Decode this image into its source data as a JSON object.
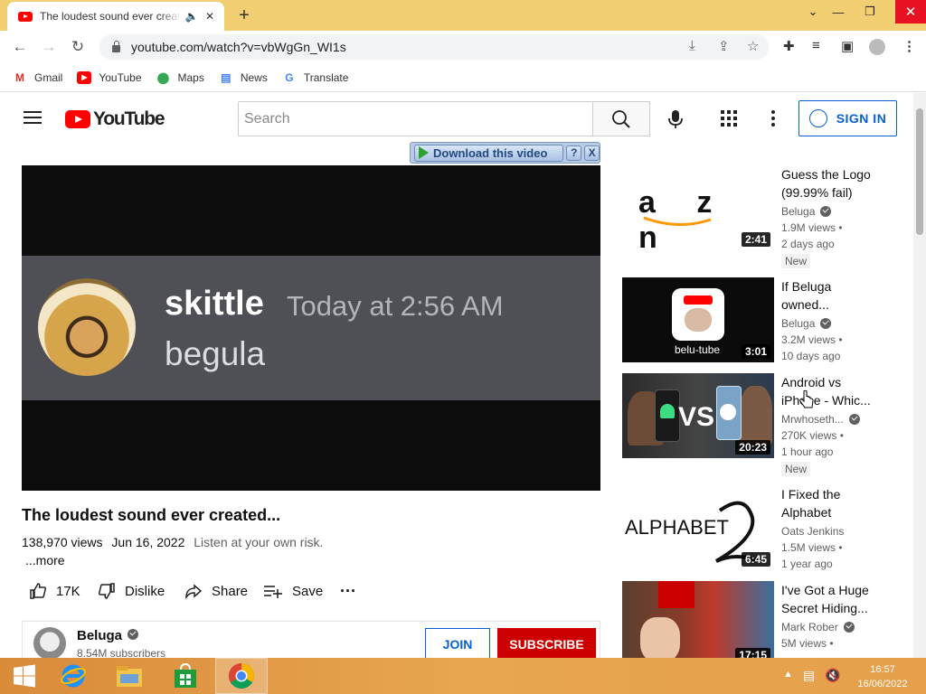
{
  "browser": {
    "tab_title": "The loudest sound ever created...",
    "url": "youtube.com/watch?v=vbWgGn_WI1s",
    "bookmarks": [
      "Gmail",
      "YouTube",
      "Maps",
      "News",
      "Translate"
    ]
  },
  "header": {
    "search_placeholder": "Search",
    "signin_label": "SIGN IN"
  },
  "extension": {
    "download_label": "Download this video",
    "help_label": "?",
    "close_label": "X"
  },
  "video": {
    "frame_name": "skittle",
    "frame_time": "Today at 2:56 AM",
    "frame_message": "begula",
    "title": "The loudest sound ever created...",
    "views": "138,970 views",
    "date": "Jun 16, 2022",
    "description": "Listen at your own risk.",
    "more": "...more",
    "likes": "17K",
    "dislike_label": "Dislike",
    "share_label": "Share",
    "save_label": "Save"
  },
  "channel": {
    "name": "Beluga",
    "subscribers": "8.54M subscribers",
    "join_label": "JOIN",
    "subscribe_label": "SUBSCRIBE"
  },
  "recommendations": [
    {
      "title": "Guess the Logo (99.99% fail)",
      "channel": "Beluga",
      "views": "1.9M views •",
      "age": "2 days ago",
      "badge": "New",
      "duration": "2:41",
      "thumb_text": "a  z  n"
    },
    {
      "title": "If Beluga owned...",
      "channel": "Beluga",
      "views": "3.2M views •",
      "age": "10 days ago",
      "badge": "",
      "duration": "3:01",
      "thumb_text": "belu-tube"
    },
    {
      "title": "Android vs iPhone - Whic...",
      "channel": "Mrwhoseth...",
      "views": "270K views •",
      "age": "1 hour ago",
      "badge": "New",
      "duration": "20:23",
      "thumb_text": "VS"
    },
    {
      "title": "I Fixed the Alphabet",
      "channel": "Oats Jenkins",
      "views": "1.5M views •",
      "age": "1 year ago",
      "badge": "",
      "duration": "6:45",
      "thumb_text": "ALPHABET"
    },
    {
      "title": "I've Got a Huge Secret Hiding...",
      "channel": "Mark Rober",
      "views": "5M views •",
      "age": "",
      "badge": "",
      "duration": "17:15",
      "thumb_text": ""
    }
  ],
  "taskbar": {
    "time": "16:57",
    "date": "16/06/2022"
  },
  "colors": {
    "accent_blue": "#065fd4",
    "subscribe_red": "#cc0000",
    "chrome_frame": "#f2cf73"
  }
}
